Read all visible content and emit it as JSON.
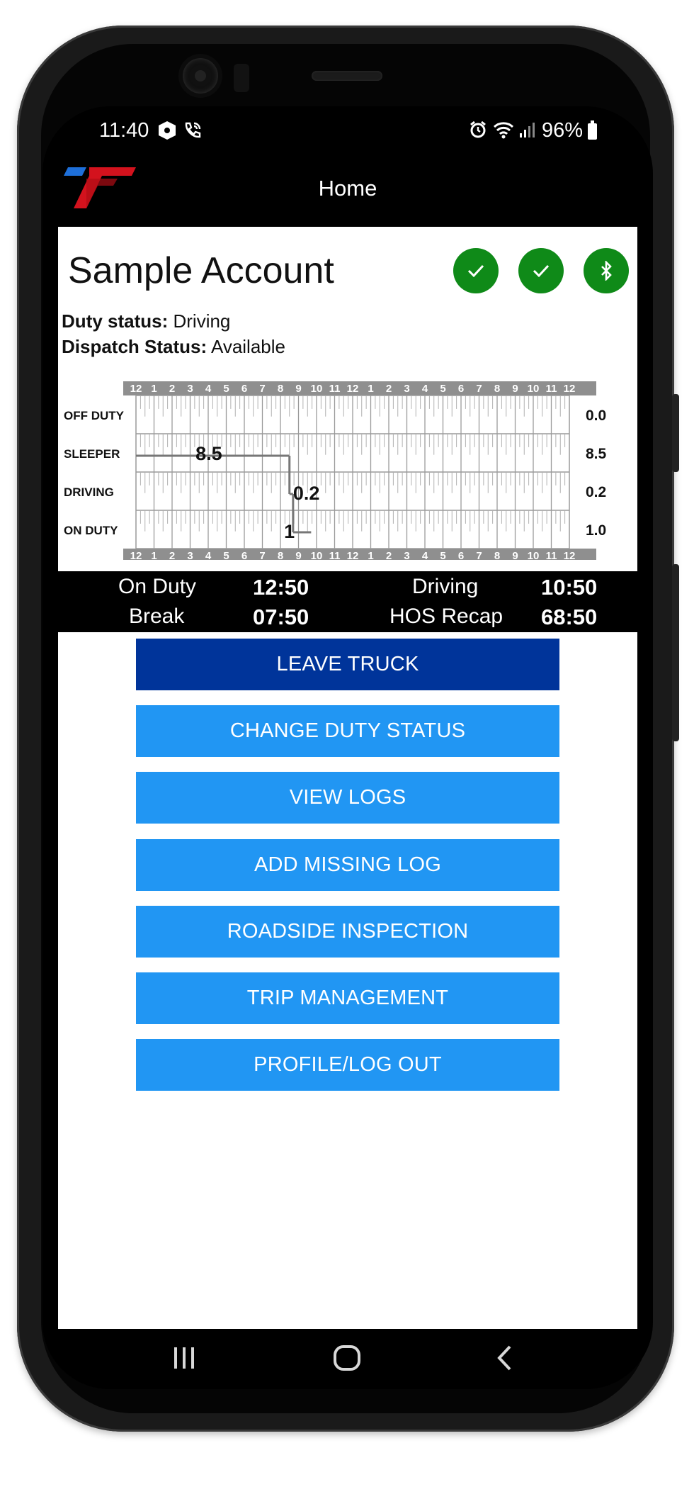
{
  "status_bar": {
    "time": "11:40",
    "battery": "96%"
  },
  "header": {
    "title": "Home"
  },
  "account": {
    "name": "Sample Account"
  },
  "duty": {
    "duty_label": "Duty status:",
    "duty_value": "Driving",
    "dispatch_label": "Dispatch Status:",
    "dispatch_value": "Available"
  },
  "log_grid": {
    "hours": [
      "12",
      "1",
      "2",
      "3",
      "4",
      "5",
      "6",
      "7",
      "8",
      "9",
      "10",
      "11",
      "12",
      "1",
      "2",
      "3",
      "4",
      "5",
      "6",
      "7",
      "8",
      "9",
      "10",
      "11",
      "12"
    ],
    "rows": [
      {
        "label": "OFF DUTY",
        "total": "0.0"
      },
      {
        "label": "SLEEPER",
        "total": "8.5"
      },
      {
        "label": "DRIVING",
        "total": "0.2"
      },
      {
        "label": "ON DUTY",
        "total": "1.0"
      }
    ],
    "annotations": {
      "sleeper": "8.5",
      "driving": "0.2",
      "on_duty": "1"
    },
    "segments": [
      {
        "row": 1,
        "start": 0,
        "end": 8.5
      },
      {
        "row": 2,
        "start": 8.5,
        "end": 8.7
      },
      {
        "row": 3,
        "start": 8.7,
        "end": 9.7
      }
    ]
  },
  "hos": {
    "on_duty_label": "On Duty",
    "on_duty_value": "12:50",
    "driving_label": "Driving",
    "driving_value": "10:50",
    "break_label": "Break",
    "break_value": "07:50",
    "recap_label": "HOS Recap",
    "recap_value": "68:50"
  },
  "buttons": {
    "leave_truck": "LEAVE TRUCK",
    "change_duty_status": "CHANGE DUTY STATUS",
    "view_logs": "VIEW LOGS",
    "add_missing_log": "ADD MISSING LOG",
    "roadside_inspection": "ROADSIDE INSPECTION",
    "trip_management": "TRIP MANAGEMENT",
    "profile_log_out": "PROFILE/LOG OUT"
  },
  "colors": {
    "header_bg": "#000000",
    "status_ok": "#0f8a18",
    "primary_dark": "#00349a",
    "primary": "#2196f3",
    "logo_red": "#d3121d",
    "logo_blue": "#1e6fd9"
  },
  "icons": {
    "status_sync": "check-icon",
    "status_connection": "check-icon",
    "bluetooth": "bluetooth-icon"
  }
}
